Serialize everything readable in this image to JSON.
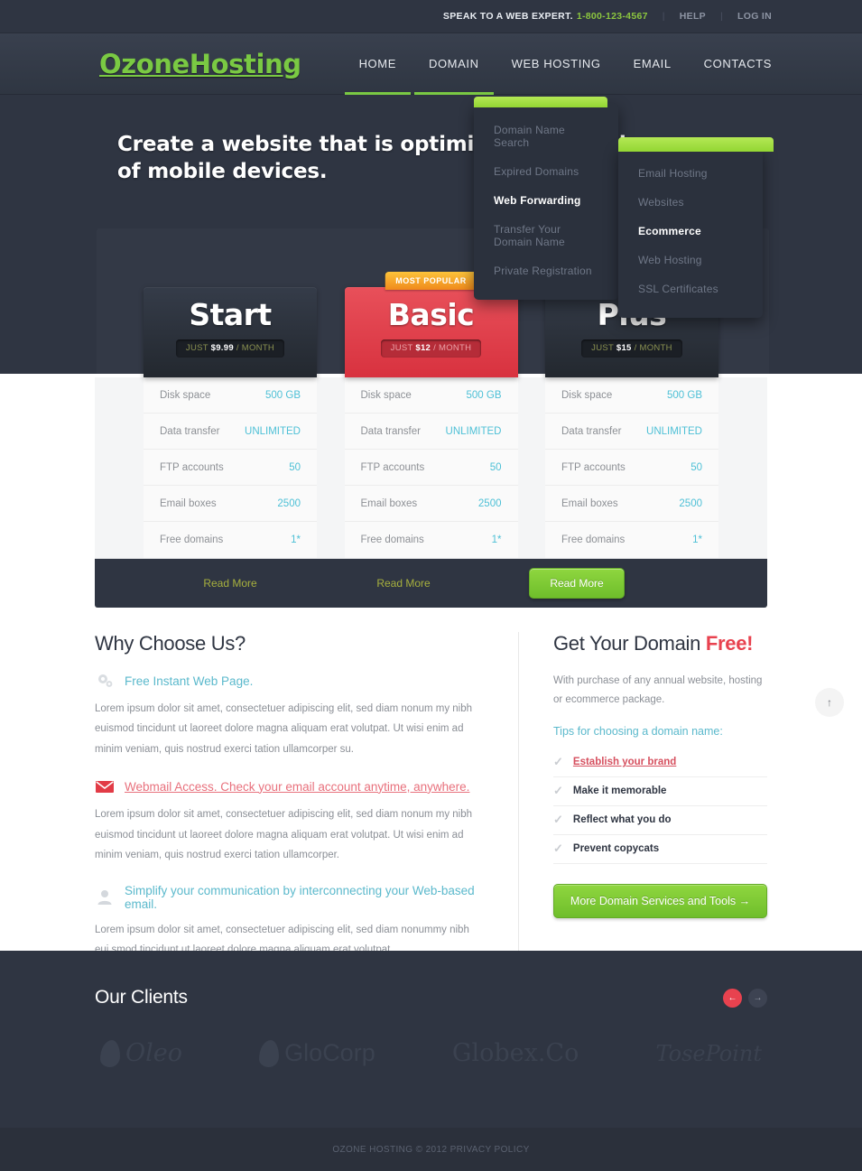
{
  "topbar": {
    "speak_label": "SPEAK TO A WEB EXPERT.",
    "phone": "1-800-123-4567",
    "help": "HELP",
    "login": "LOG IN"
  },
  "header": {
    "logo": "OzoneHosting",
    "nav": [
      {
        "label": "HOME"
      },
      {
        "label": "DOMAIN"
      },
      {
        "label": "WEB HOSTING"
      },
      {
        "label": "EMAIL"
      },
      {
        "label": "CONTACTS"
      }
    ]
  },
  "dropdowns": {
    "domain": {
      "items": [
        {
          "label": "Domain Name Search",
          "highlighted": false
        },
        {
          "label": "Expired Domains",
          "highlighted": false
        },
        {
          "label": "Web Forwarding",
          "highlighted": true
        },
        {
          "label": "Transfer Your Domain Name",
          "highlighted": false
        },
        {
          "label": "Private Registration",
          "highlighted": false
        }
      ]
    },
    "webhosting": {
      "items": [
        {
          "label": "Email Hosting",
          "highlighted": false
        },
        {
          "label": "Websites",
          "highlighted": false
        },
        {
          "label": "Ecommerce",
          "highlighted": true
        },
        {
          "label": "Web Hosting",
          "highlighted": false
        },
        {
          "label": "SSL Certificates",
          "highlighted": false
        }
      ]
    }
  },
  "hero": {
    "headline": "Create a website that is optimized for the size of mobile devices."
  },
  "pricing": {
    "popular_badge": "MOST POPULAR",
    "feature_labels": [
      "Disk space",
      "Data transfer",
      "FTP accounts",
      "Email boxes",
      "Free domains"
    ],
    "read_more": "Read More",
    "plans": [
      {
        "name": "Start",
        "price_prefix": "JUST",
        "price": "$9.99",
        "price_suffix": "/ MONTH",
        "popular": false,
        "values": [
          "500 GB",
          "UNLIMITED",
          "50",
          "2500",
          "1*"
        ]
      },
      {
        "name": "Basic",
        "price_prefix": "JUST",
        "price": "$12",
        "price_suffix": "/ MONTH",
        "popular": true,
        "values": [
          "500 GB",
          "UNLIMITED",
          "50",
          "2500",
          "1*"
        ]
      },
      {
        "name": "Plus",
        "price_prefix": "JUST",
        "price": "$15",
        "price_suffix": "/ MONTH",
        "popular": false,
        "values": [
          "500 GB",
          "UNLIMITED",
          "50",
          "2500",
          "1*"
        ]
      }
    ]
  },
  "why": {
    "title": "Why Choose Us?",
    "items": [
      {
        "icon": "gears-icon",
        "link": "Free Instant Web Page.",
        "style": "blue",
        "body": "Lorem ipsum dolor sit amet, consectetuer adipiscing elit, sed diam nonum my nibh euismod tincidunt ut laoreet dolore magna aliquam erat volutpat. Ut wisi enim ad minim veniam, quis nostrud exerci tation ullamcorper su."
      },
      {
        "icon": "envelope-icon",
        "link": "Webmail Access. Check your email account anytime, anywhere.",
        "style": "red",
        "body": "Lorem ipsum dolor sit amet, consectetuer adipiscing elit, sed diam nonum my nibh euismod tincidunt ut laoreet dolore magna aliquam erat volutpat. Ut wisi enim ad minim veniam, quis nostrud exerci tation ullamcorper."
      },
      {
        "icon": "user-icon",
        "link": "Simplify your communication by interconnecting your Web-based email.",
        "style": "blue",
        "body": "Lorem ipsum dolor sit amet, consectetuer adipiscing elit, sed diam nonummy nibh eui smod tincidunt ut laoreet dolore magna aliquam erat volutpat."
      }
    ]
  },
  "domain_panel": {
    "title_plain": "Get Your Domain ",
    "title_accent": "Free!",
    "lede": "With purchase of any annual website, hosting or ecommerce package.",
    "tips_heading": "Tips for choosing a domain name:",
    "tips": [
      {
        "label": "Establish your brand",
        "linked": true
      },
      {
        "label": "Make it memorable",
        "linked": false
      },
      {
        "label": "Reflect what you do",
        "linked": false
      },
      {
        "label": "Prevent copycats",
        "linked": false
      }
    ],
    "button": "More Domain Services and Tools  →"
  },
  "clients": {
    "title": "Our Clients",
    "prev_icon": "←",
    "next_icon": "→",
    "logos": [
      {
        "name": "Oleo",
        "mark": true
      },
      {
        "name": "GloCorp",
        "mark": true
      },
      {
        "name": "Globex.Co",
        "mark": false
      },
      {
        "name": "TosePoint",
        "mark": false
      }
    ]
  },
  "footer": {
    "text": "OZONE HOSTING © 2012 PRIVACY POLICY"
  },
  "scroll_top": {
    "icon": "↑"
  },
  "colors": {
    "accent_green": "#7ac943",
    "dark": "#2f3542",
    "red": "#e8424f",
    "teal": "#4ec0d6",
    "orange": "#f3a02a"
  }
}
